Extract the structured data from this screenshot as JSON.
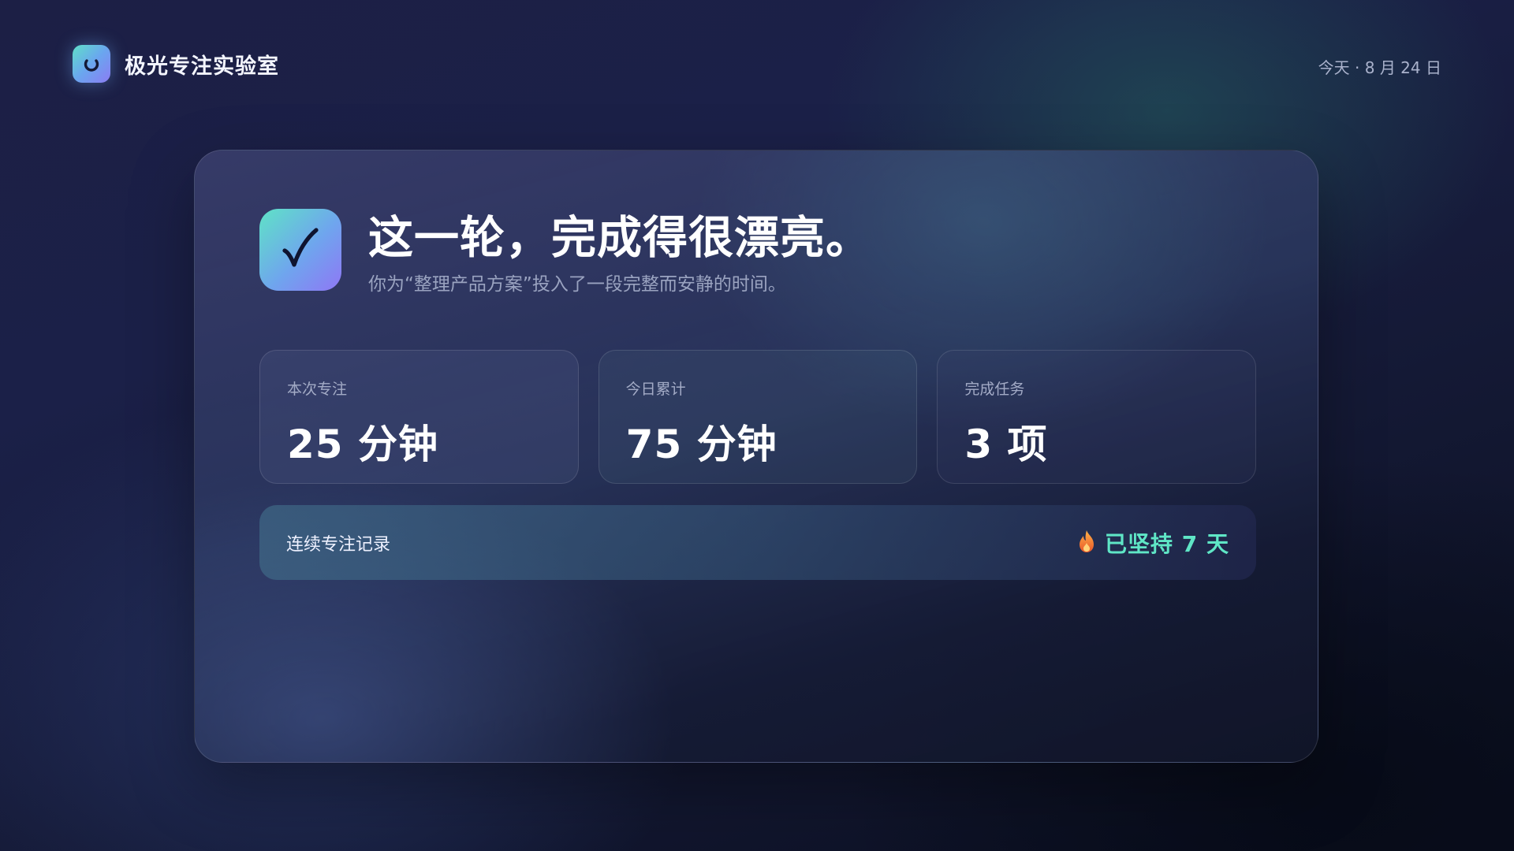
{
  "app": {
    "name": "极光专注实验室",
    "logo_icon": "loop-icon",
    "date": "今天 · 8 月 24 日"
  },
  "summary": {
    "icon": "checkmark-icon",
    "title": "这一轮，完成得很漂亮。",
    "subtitle": "你为“整理产品方案”投入了一段完整而安静的时间。"
  },
  "stats": [
    {
      "label": "本次专注",
      "value": "25 分钟"
    },
    {
      "label": "今日累计",
      "value": "75 分钟"
    },
    {
      "label": "完成任务",
      "value": "3 项"
    }
  ],
  "streak": {
    "label": "连续专注记录",
    "icon": "flame-icon",
    "value": "已坚持 7 天"
  },
  "colors": {
    "accent_teal": "#5fe6c6",
    "accent_purple": "#8f77f5",
    "accent_blue": "#6fa5ee",
    "flame": "#f08a2e"
  }
}
